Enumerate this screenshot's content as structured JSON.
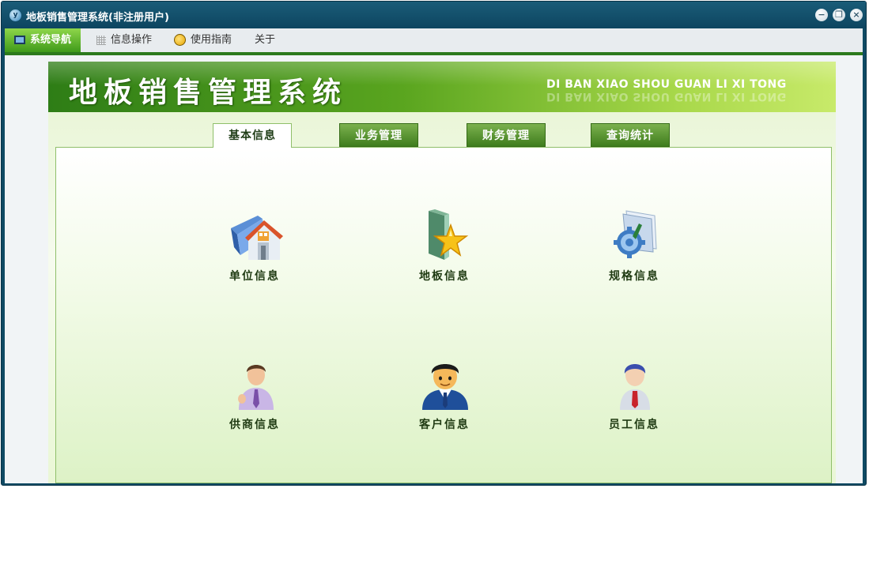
{
  "window": {
    "title": "地板销售管理系统(非注册用户)"
  },
  "menu": {
    "items": [
      {
        "label": "系统导航",
        "icon": "monitor-icon",
        "active": true
      },
      {
        "label": "信息操作",
        "icon": "grid-icon",
        "active": false
      },
      {
        "label": "使用指南",
        "icon": "guide-icon",
        "active": false
      },
      {
        "label": "关于",
        "icon": "",
        "active": false
      }
    ]
  },
  "banner": {
    "title": "地板销售管理系统",
    "subtitle": "DI BAN XIAO SHOU GUAN LI XI TONG"
  },
  "tabs": [
    {
      "label": "基本信息",
      "active": true
    },
    {
      "label": "业务管理",
      "active": false
    },
    {
      "label": "财务管理",
      "active": false
    },
    {
      "label": "查询统计",
      "active": false
    }
  ],
  "items": [
    {
      "label": "单位信息",
      "icon": "building-folder-icon"
    },
    {
      "label": "地板信息",
      "icon": "star-folder-icon"
    },
    {
      "label": "规格信息",
      "icon": "gear-folder-icon"
    },
    {
      "label": "供商信息",
      "icon": "supplier-person-icon"
    },
    {
      "label": "客户信息",
      "icon": "customer-person-icon"
    },
    {
      "label": "员工信息",
      "icon": "employee-person-icon"
    }
  ],
  "colors": {
    "titlebar": "#0f4a63",
    "accent_green": "#3f9a1a",
    "label_text": "#1f3a12"
  }
}
